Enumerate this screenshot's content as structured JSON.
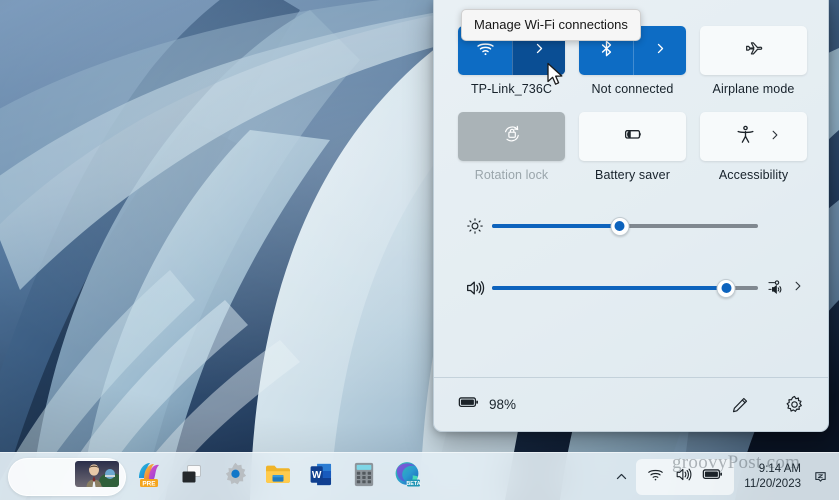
{
  "desktop": {
    "wallpaper_name": "windows-11-bloom-wallpaper",
    "watermark": "groovyPost.com"
  },
  "tooltip": {
    "text": "Manage Wi-Fi connections"
  },
  "quick_settings": {
    "tiles": [
      {
        "id": "wifi",
        "label": "TP-Link_736C",
        "icon": "wifi-icon",
        "state": "on",
        "has_chevron": true,
        "chevron_hovered": true
      },
      {
        "id": "bluetooth",
        "label": "Not connected",
        "icon": "bluetooth-icon",
        "state": "on",
        "has_chevron": true,
        "chevron_hovered": false
      },
      {
        "id": "airplane-mode",
        "label": "Airplane mode",
        "icon": "airplane-icon",
        "state": "off",
        "has_chevron": false,
        "chevron_hovered": false
      },
      {
        "id": "rotation-lock",
        "label": "Rotation lock",
        "icon": "rotation-lock-icon",
        "state": "disabled",
        "has_chevron": false,
        "chevron_hovered": false
      },
      {
        "id": "battery-saver",
        "label": "Battery saver",
        "icon": "battery-saver-icon",
        "state": "off",
        "has_chevron": false,
        "chevron_hovered": false
      },
      {
        "id": "accessibility",
        "label": "Accessibility",
        "icon": "accessibility-icon",
        "state": "off",
        "has_chevron": false,
        "inline_chevron": true,
        "chevron_hovered": false
      }
    ],
    "sliders": [
      {
        "id": "brightness",
        "icon": "brightness-icon",
        "value": 48
      },
      {
        "id": "volume",
        "icon": "volume-icon",
        "value": 88,
        "trailing_icon": "audio-output-icon",
        "trailing_chevron": ">"
      }
    ],
    "footer": {
      "battery_icon": "battery-full-icon",
      "battery_percent": "98%",
      "edit_icon": "pencil-edit-icon",
      "settings_icon": "gear-settings-icon"
    }
  },
  "taskbar": {
    "items": [
      {
        "id": "photos-active",
        "icon": "photo-thumbnail",
        "active": true
      },
      {
        "id": "copilot",
        "icon": "copilot-pre-icon",
        "active": false
      },
      {
        "id": "task-view",
        "icon": "task-view-icon",
        "active": false
      },
      {
        "id": "settings",
        "icon": "settings-gear-icon",
        "active": false
      },
      {
        "id": "file-explorer",
        "icon": "file-explorer-icon",
        "active": false
      },
      {
        "id": "word",
        "icon": "microsoft-word-icon",
        "active": false
      },
      {
        "id": "calculator",
        "icon": "calculator-icon",
        "active": false
      },
      {
        "id": "edge-beta",
        "icon": "microsoft-edge-beta-icon",
        "active": false
      }
    ],
    "tray": {
      "chevron": "show-hidden-icons-chevron",
      "icons": [
        "wifi-tray-icon",
        "volume-tray-icon",
        "battery-tray-icon"
      ],
      "time": "9:14 AM",
      "date": "11/20/2023",
      "notification_icon": "notification-bell-icon"
    }
  },
  "colors": {
    "accent_blue": "#0d6cc4",
    "accent_blue_dark": "#0a4e94",
    "tile_off": "#f7fafb",
    "tile_disabled": "#aab3b7",
    "panel_bg": "#e4edf2",
    "slider_fill": "#0d63bd",
    "slider_track": "#808890"
  }
}
